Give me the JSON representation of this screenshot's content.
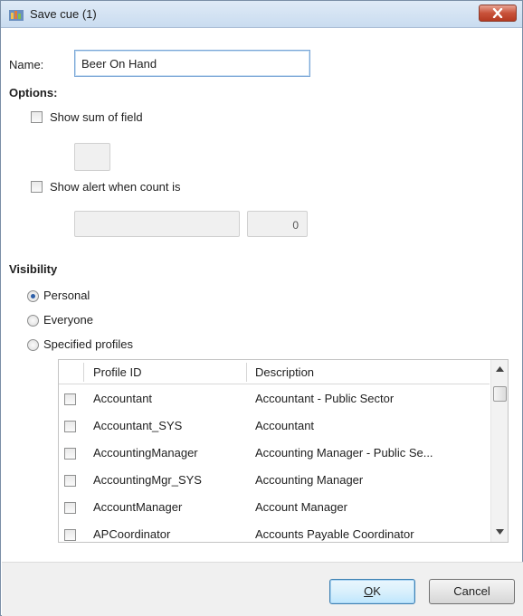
{
  "window": {
    "title": "Save cue (1)",
    "accent_color": "#c8523a"
  },
  "form": {
    "name_label": "Name:",
    "name_value": "Beer On Hand",
    "options_heading": "Options:",
    "show_sum_label": "Show sum of field",
    "show_sum_checked": false,
    "show_alert_label": "Show alert when count is",
    "show_alert_checked": false,
    "alert_count_value": "0"
  },
  "visibility": {
    "heading": "Visibility",
    "options": [
      {
        "label": "Personal",
        "selected": true
      },
      {
        "label": "Everyone",
        "selected": false
      },
      {
        "label": "Specified profiles",
        "selected": false
      }
    ]
  },
  "profiles_table": {
    "columns": [
      "Profile ID",
      "Description"
    ],
    "rows": [
      {
        "id": "Accountant",
        "description": "Accountant - Public Sector"
      },
      {
        "id": "Accountant_SYS",
        "description": "Accountant"
      },
      {
        "id": "AccountingManager",
        "description": "Accounting Manager - Public Se..."
      },
      {
        "id": "AccountingMgr_SYS",
        "description": "Accounting Manager"
      },
      {
        "id": "AccountManager",
        "description": "Account Manager"
      },
      {
        "id": "APCoordinator",
        "description": "Accounts Payable Coordinator"
      }
    ]
  },
  "buttons": {
    "ok_label": "OK",
    "ok_mnemonic": "O",
    "cancel_label": "Cancel"
  }
}
